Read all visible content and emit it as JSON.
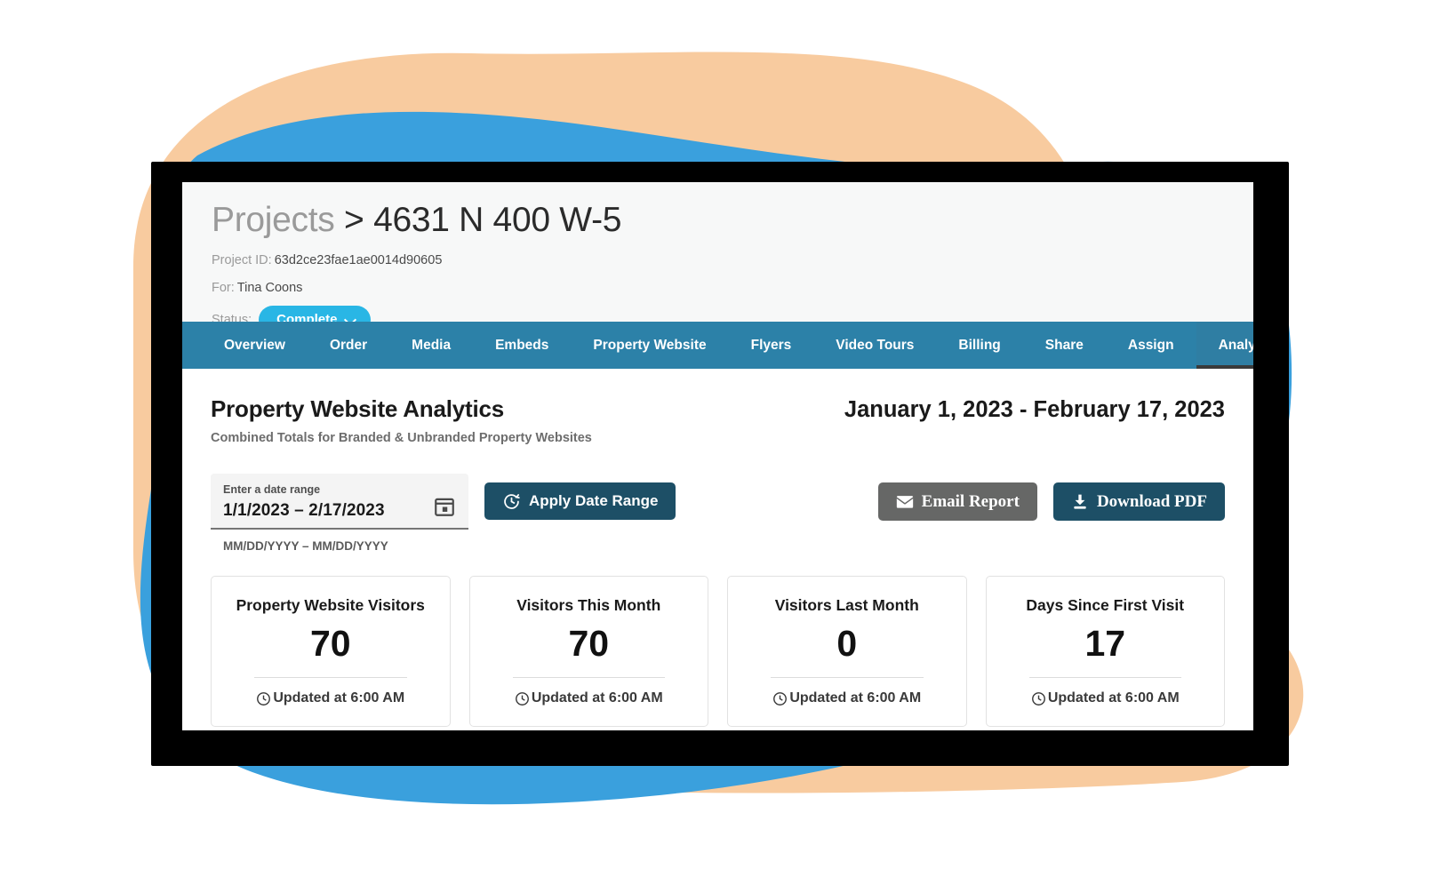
{
  "theme": {
    "blob_blue": "#3aa0dd",
    "blob_peach": "#f8cb9f",
    "nav_blue": "#2c81a8",
    "nav_active_blue": "#2f7ea3",
    "status_cyan": "#29b6e5",
    "dark_teal": "#1d4f66",
    "gray_button": "#666766",
    "shadow_black": "#000000"
  },
  "header": {
    "breadcrumb_root": "Projects",
    "breadcrumb_separator": ">",
    "breadcrumb_current": "4631 N 400 W-5",
    "project_id_label": "Project ID:",
    "project_id_value": "63d2ce23fae1ae0014d90605",
    "for_label": "For:",
    "for_value": "Tina Coons",
    "status_label": "Status:",
    "status_value": "Complete"
  },
  "nav": {
    "items": [
      {
        "label": "Overview",
        "active": false
      },
      {
        "label": "Order",
        "active": false
      },
      {
        "label": "Media",
        "active": false
      },
      {
        "label": "Embeds",
        "active": false
      },
      {
        "label": "Property Website",
        "active": false
      },
      {
        "label": "Flyers",
        "active": false
      },
      {
        "label": "Video Tours",
        "active": false
      },
      {
        "label": "Billing",
        "active": false
      },
      {
        "label": "Share",
        "active": false
      },
      {
        "label": "Assign",
        "active": false
      },
      {
        "label": "Analytics",
        "active": true
      }
    ]
  },
  "analytics": {
    "title": "Property Website Analytics",
    "subtitle": "Combined Totals for Branded & Unbranded Property Websites",
    "date_range_display": "January 1, 2023 - February 17, 2023",
    "date_field": {
      "label": "Enter a date range",
      "value": "1/1/2023 – 2/17/2023",
      "placeholder": "MM/DD/YYYY – MM/DD/YYYY",
      "hint": "MM/DD/YYYY – MM/DD/YYYY",
      "calendar_icon": "calendar-icon"
    },
    "buttons": {
      "apply": {
        "label": "Apply Date Range",
        "icon": "refresh-clock-icon"
      },
      "email": {
        "label": "Email Report",
        "icon": "envelope-icon"
      },
      "pdf": {
        "label": "Download PDF",
        "icon": "download-icon"
      }
    },
    "cards": [
      {
        "title": "Property Website Visitors",
        "value": "70",
        "updated": "Updated at 6:00 AM",
        "icon": "clock-icon"
      },
      {
        "title": "Visitors This Month",
        "value": "70",
        "updated": "Updated at 6:00 AM",
        "icon": "clock-icon"
      },
      {
        "title": "Visitors Last Month",
        "value": "0",
        "updated": "Updated at 6:00 AM",
        "icon": "clock-icon"
      },
      {
        "title": "Days Since First Visit",
        "value": "17",
        "updated": "Updated at 6:00 AM",
        "icon": "clock-icon"
      }
    ]
  }
}
